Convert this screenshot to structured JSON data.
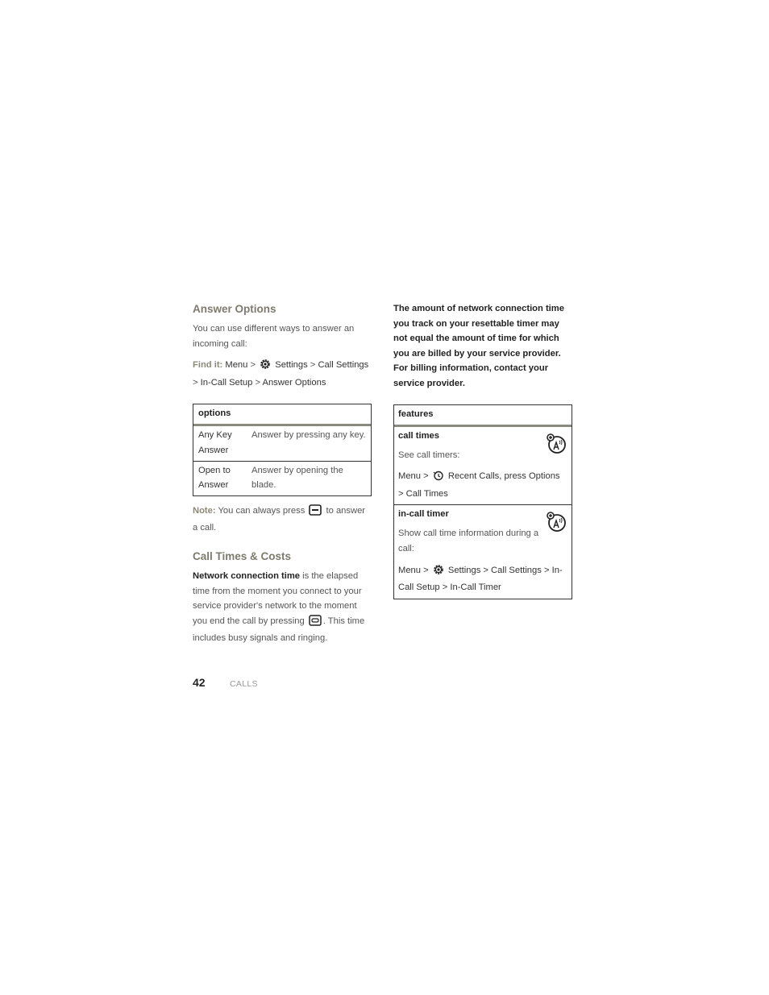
{
  "left": {
    "answer_options": {
      "heading": "Answer Options",
      "intro": "You can use different ways to answer an incoming call:",
      "find_it_label": "Find it:",
      "path": [
        "Menu",
        "Settings",
        "Call Settings",
        "In-Call Setup",
        "Answer Options"
      ],
      "path_icon": "settings-gear-icon"
    },
    "options_table": {
      "header": "options",
      "rows": [
        {
          "name": "Any Key Answer",
          "description": "Answer by pressing any key."
        },
        {
          "name": "Open to Answer",
          "description": "Answer by opening the blade."
        }
      ]
    },
    "note": {
      "label": "Note:",
      "text_before": "You can always press",
      "key_icon": "send-key-icon",
      "text_after": "to answer a call."
    },
    "call_times": {
      "heading": "Call Times & Costs",
      "term": "Network connection time",
      "text_1": "is the elapsed time from the moment you connect to your service provider's network to the moment you end the call by pressing",
      "key_icon": "end-key-icon",
      "text_2": ". This time includes busy signals and ringing."
    }
  },
  "right": {
    "billing_note": "The amount of network connection time you track on your resettable timer may not equal the amount of time for which you are billed by your service provider. For billing information, contact your service provider.",
    "features_table": {
      "header": "features",
      "items": [
        {
          "title": "call times",
          "description": "See call timers:",
          "path_1": "Menu >",
          "icon": "recent-calls-icon",
          "path_2": "Recent Calls",
          "path_3": ", press Options > Call Times",
          "badge_icon": "network-dependent-icon"
        },
        {
          "title": "in-call timer",
          "description": "Show call time information during a call:",
          "path_1": "Menu >",
          "icon": "settings-gear-icon",
          "path_2": "Settings > Call Settings > In-Call Setup > In-Call Timer",
          "badge_icon": "network-dependent-icon"
        }
      ]
    }
  },
  "footer": {
    "page_number": "42",
    "section": "CALLS"
  }
}
